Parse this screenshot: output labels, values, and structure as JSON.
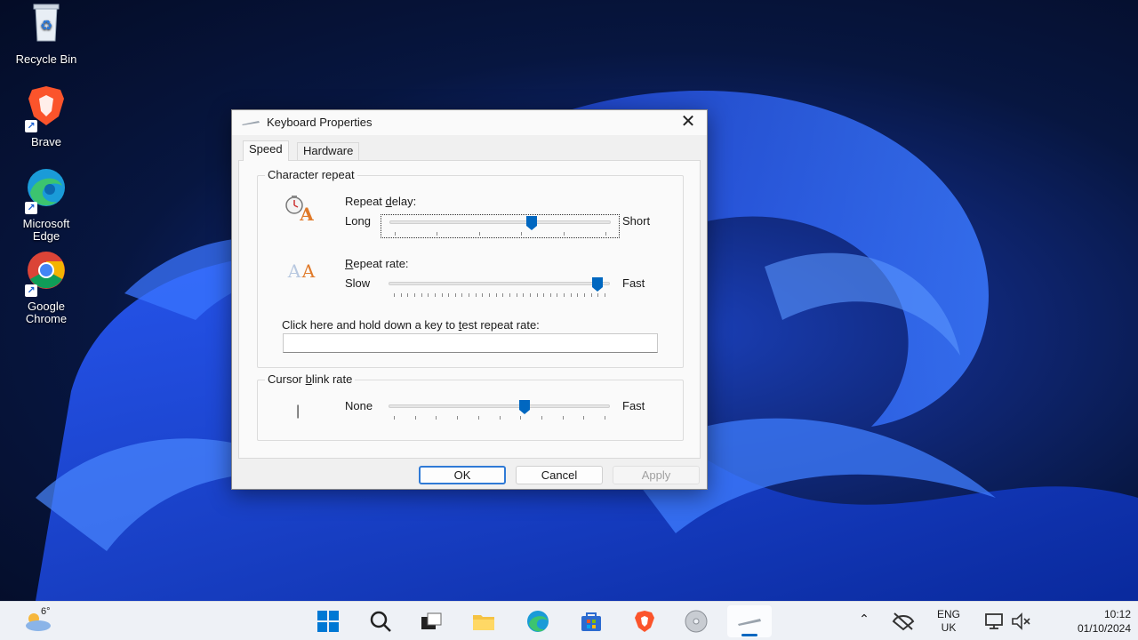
{
  "desktop": {
    "icons": [
      {
        "label": "Recycle Bin"
      },
      {
        "label": "Brave"
      },
      {
        "label": "Microsoft Edge"
      },
      {
        "label": "Google Chrome"
      }
    ]
  },
  "dialog": {
    "title": "Keyboard Properties",
    "close_glyph": "✕",
    "tabs": [
      {
        "label": "Speed",
        "active": true
      },
      {
        "label": "Hardware",
        "active": false
      }
    ],
    "character_repeat": {
      "group_label": "Character repeat",
      "repeat_delay": {
        "label_pre": "Repeat ",
        "label_accel": "d",
        "label_post": "elay:",
        "min_label": "Long",
        "max_label": "Short",
        "value": 0.65
      },
      "repeat_rate": {
        "label_pre": "",
        "label_accel": "R",
        "label_post": "epeat rate:",
        "min_label": "Slow",
        "max_label": "Fast",
        "value": 0.97
      },
      "test_prompt_pre": "Click here and hold down a key to ",
      "test_prompt_accel": "t",
      "test_prompt_post": "est repeat rate:",
      "test_value": ""
    },
    "cursor_blink": {
      "group_label_pre": "Cursor ",
      "group_label_accel": "b",
      "group_label_post": "link rate",
      "cursor_glyph": "|",
      "min_label": "None",
      "max_label": "Fast",
      "value": 0.62
    },
    "buttons": {
      "ok": "OK",
      "cancel": "Cancel",
      "apply": "Apply"
    }
  },
  "taskbar": {
    "weather_temp": "6°",
    "language_line1": "ENG",
    "language_line2": "UK",
    "time": "10:12",
    "date": "01/10/2024",
    "accent": "#0067c0"
  }
}
